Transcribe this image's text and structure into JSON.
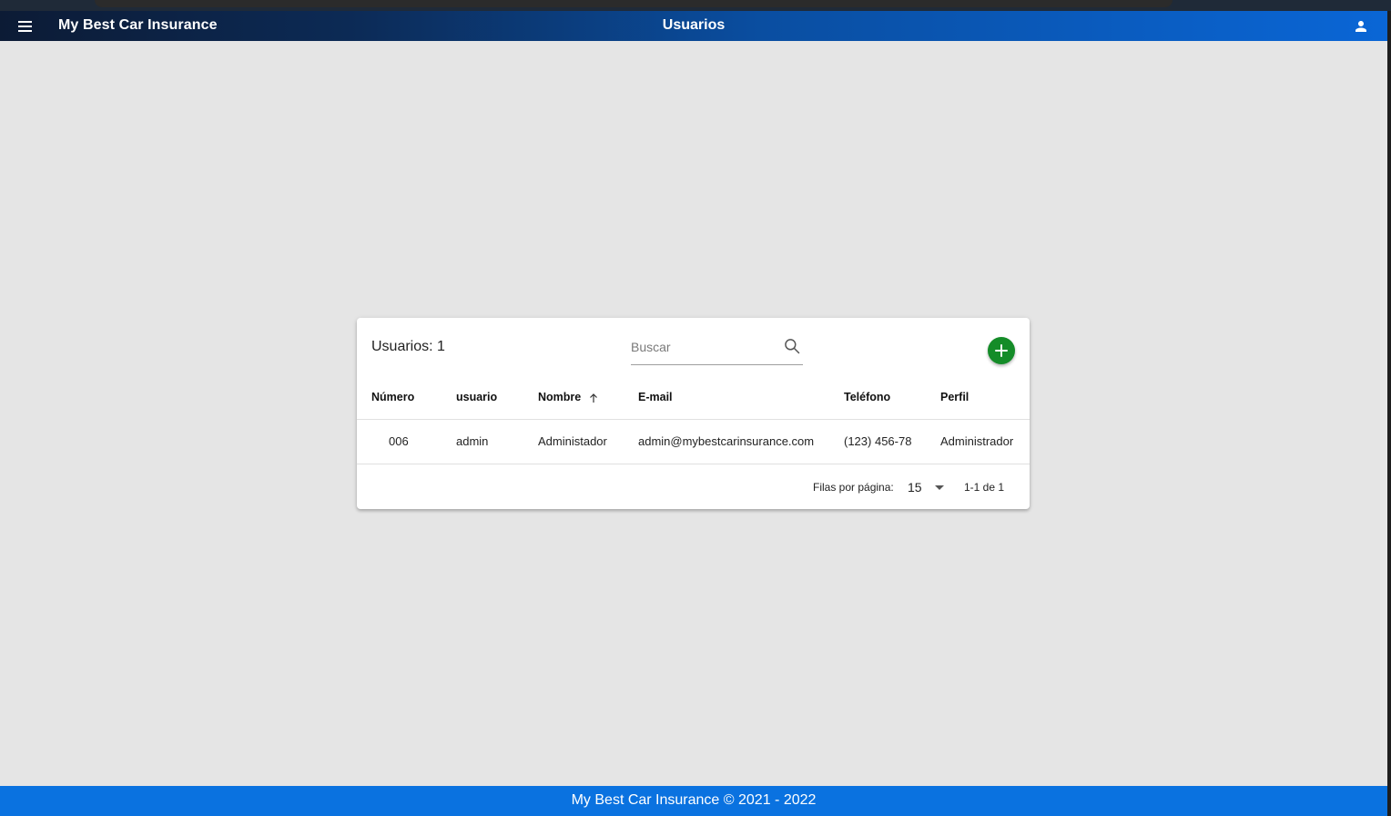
{
  "app_bar": {
    "app_title": "My Best Car Insurance",
    "page_title": "Usuarios"
  },
  "card": {
    "title": "Usuarios: 1",
    "search_placeholder": "Buscar",
    "columns": [
      "Número",
      "usuario",
      "Nombre",
      "E-mail",
      "Teléfono",
      "Perfil"
    ],
    "sorted_column": "Nombre",
    "sort_direction": "ascending",
    "rows": [
      {
        "numero": "006",
        "usuario": "admin",
        "nombre": "Administador",
        "email": "admin@mybestcarinsurance.com",
        "telefono": "(123) 456-78",
        "perfil": "Administrador"
      }
    ],
    "pagination": {
      "rows_per_page_label": "Filas por página:",
      "rows_per_page_value": "15",
      "range": "1-1 de 1"
    }
  },
  "footer": {
    "text": "My Best Car Insurance © 2021 - 2022"
  },
  "colors": {
    "app_bar_start": "#0c1b35",
    "app_bar_end": "#0a66d6",
    "background": "#e5e5e5",
    "add_button": "#148c28",
    "footer": "#0a72e0"
  },
  "icons": {
    "menu": "menu-icon",
    "user": "account-icon",
    "search": "search-icon",
    "add": "plus-icon",
    "sort": "arrow-up-icon",
    "rows_select": "caret-down-icon"
  }
}
